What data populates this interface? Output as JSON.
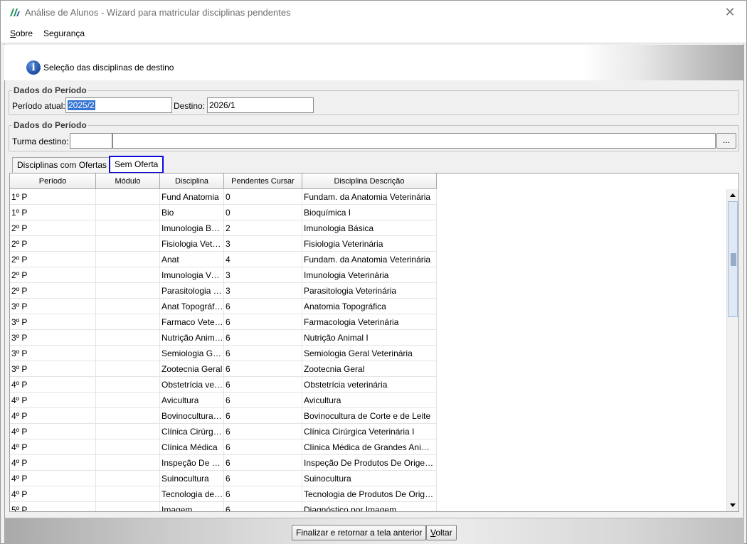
{
  "window": {
    "title": "Análise de Alunos - Wizard para matricular disciplinas pendentes",
    "close_glyph": "✕"
  },
  "menu": [
    {
      "label": "Sobre",
      "accel": "S",
      "rest": "obre"
    },
    {
      "label": "Segurança"
    }
  ],
  "banner": {
    "icon": "info-icon",
    "text": "Seleção das disciplinas de destino"
  },
  "periodo_group": {
    "title": "Dados do Período",
    "atual_label": "Período atual:",
    "atual_value": "2025/2",
    "destino_label": "Destino:",
    "destino_value": "2026/1"
  },
  "turma_group": {
    "title": "Dados do Período",
    "turma_label": "Turma destino:",
    "turma_code": "",
    "turma_name": "",
    "browse_label": "..."
  },
  "tabs": [
    {
      "label": "Disciplinas com Ofertas",
      "active": false
    },
    {
      "label": "Sem Oferta",
      "active": true
    }
  ],
  "grid": {
    "columns": [
      "Período",
      "Módulo",
      "Disciplina",
      "Pendentes Cursar",
      "Disciplina Descrição"
    ],
    "rows": [
      [
        "1º P",
        "",
        "Fund Anatomia",
        "0",
        "Fundam. da Anatomia Veterinária"
      ],
      [
        "1º P",
        "",
        "Bio",
        "0",
        "Bioquímica I"
      ],
      [
        "2º P",
        "",
        " Imunologia Básica",
        "2",
        " Imunologia Básica"
      ],
      [
        "2º P",
        "",
        "Fisiologia Veterinária",
        "3",
        "Fisiologia Veterinária"
      ],
      [
        "2º P",
        "",
        "Anat",
        "4",
        "Fundam. da Anatomia Veterinária"
      ],
      [
        "2º P",
        "",
        "Imunologia Veterinária",
        "3",
        "Imunologia Veterinária"
      ],
      [
        "2º P",
        "",
        "Parasitologia Veterinária",
        "3",
        "Parasitologia Veterinária"
      ],
      [
        "3º P",
        "",
        "Anat Topográfica",
        "6",
        "Anatomia Topográfica"
      ],
      [
        "3º P",
        "",
        "Farmaco Veterinária",
        "6",
        "Farmacologia Veterinária"
      ],
      [
        "3º P",
        "",
        "Nutrição Animal I",
        "6",
        "Nutrição Animal I"
      ],
      [
        "3º P",
        "",
        "Semiologia Geral",
        "6",
        "Semiologia Geral Veterinária"
      ],
      [
        "3º P",
        "",
        "Zootecnia Geral",
        "6",
        "Zootecnia Geral"
      ],
      [
        "4º P",
        "",
        " Obstetrícia veterinária",
        "6",
        " Obstetrícia veterinária"
      ],
      [
        "4º P",
        "",
        "Avicultura",
        "6",
        "Avicultura"
      ],
      [
        "4º P",
        "",
        "Bovinocultura de Corte",
        "6",
        "Bovinocultura de Corte e de Leite"
      ],
      [
        "4º P",
        "",
        "Clínica Cirúrgica",
        "6",
        "Clínica Cirúrgica Veterinária I"
      ],
      [
        "4º P",
        "",
        "Clínica Médica",
        "6",
        "Clínica Médica de Grandes Animais"
      ],
      [
        "4º P",
        "",
        "Inspeção De Produtos",
        "6",
        "Inspeção De Produtos De Origem Animal"
      ],
      [
        "4º P",
        "",
        "Suinocultura",
        "6",
        "Suinocultura"
      ],
      [
        "4º P",
        "",
        "Tecnologia de Produtos",
        "6",
        "Tecnologia de Produtos De Origem Animal"
      ],
      [
        "5º P",
        "",
        "Imagem",
        "6",
        "Diagnóstico por Imagem"
      ]
    ]
  },
  "footer": {
    "finish_label": "Finalizar e retornar a tela anterior",
    "back_label": "Voltar",
    "back_accel": "V",
    "back_rest": "oltar"
  },
  "colors": {
    "active_tab_border": "#0a0ae0",
    "selection": "#3575d3",
    "info_icon": "#1d4fa3"
  }
}
